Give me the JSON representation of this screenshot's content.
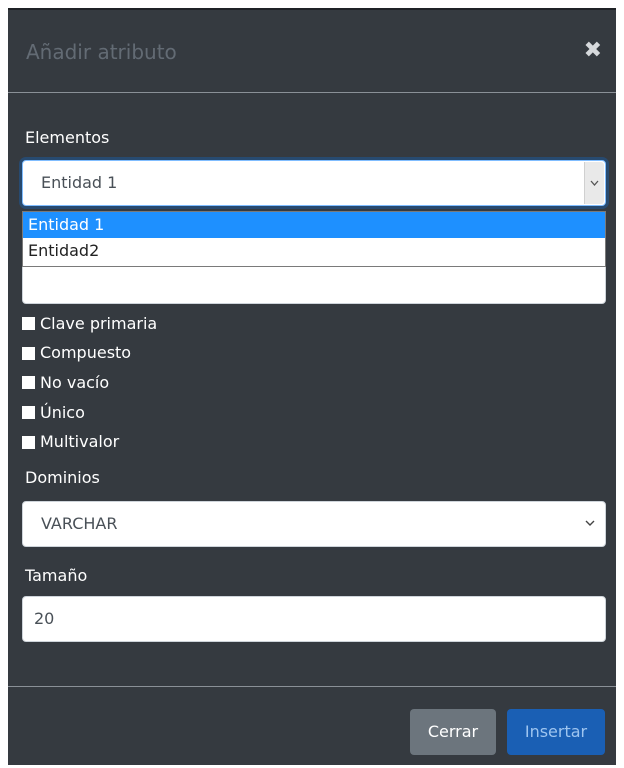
{
  "modal": {
    "title": "Añadir atributo",
    "close_symbol": "✖"
  },
  "elementos": {
    "label": "Elementos",
    "selected": "Entidad 1",
    "options": [
      "Entidad 1",
      "Entidad2"
    ]
  },
  "nombre": {
    "value": ""
  },
  "checkboxes": [
    {
      "label": "Clave primaria",
      "checked": false
    },
    {
      "label": "Compuesto",
      "checked": false
    },
    {
      "label": "No vacío",
      "checked": false
    },
    {
      "label": "Único",
      "checked": false
    },
    {
      "label": "Multivalor",
      "checked": false
    }
  ],
  "dominios": {
    "label": "Dominios",
    "selected": "VARCHAR"
  },
  "tamano": {
    "label": "Tamaño",
    "value": "20"
  },
  "footer": {
    "close_label": "Cerrar",
    "insert_label": "Insertar"
  },
  "colors": {
    "modal_bg": "#353a40",
    "highlight": "#1e90ff",
    "insert_button": "#1a5fb4",
    "close_button": "#6c757d"
  }
}
